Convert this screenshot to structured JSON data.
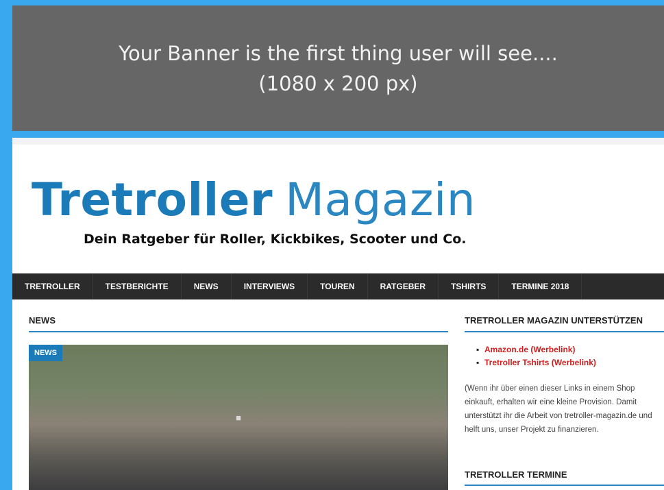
{
  "banner": {
    "line1": "Your Banner is the first thing user will see....",
    "line2": "(1080 x 200 px)"
  },
  "logo": {
    "bold": "Tretroller",
    "light": "Magazin",
    "tagline": "Dein Ratgeber für Roller, Kickbikes, Scooter und Co."
  },
  "nav": {
    "items": [
      "TRETROLLER",
      "TESTBERICHTE",
      "NEWS",
      "INTERVIEWS",
      "TOUREN",
      "RATGEBER",
      "TSHIRTS",
      "TERMINE 2018"
    ]
  },
  "main": {
    "section_title": "NEWS",
    "hero_badge": "NEWS"
  },
  "sidebar": {
    "support_title": "TRETROLLER MAGAZIN UNTERSTÜTZEN",
    "links": [
      "Amazon.de (Werbelink)",
      "Tretroller Tshirts (Werbelink)"
    ],
    "support_text": "(Wenn ihr über einen dieser Links in einem Shop einkauft, erhalten wir eine kleine Provision. Damit unterstützt ihr die Arbeit von tretroller-magazin.de und helft uns, unser Projekt zu finanzieren.",
    "termine_title": "TRETROLLER TERMINE"
  },
  "colors": {
    "accent": "#1a7bb8",
    "nav_bg": "#2b2b2b",
    "link_red": "#d11f1f",
    "banner_bg": "#666666",
    "outer_bg": "#3aa8ee"
  }
}
